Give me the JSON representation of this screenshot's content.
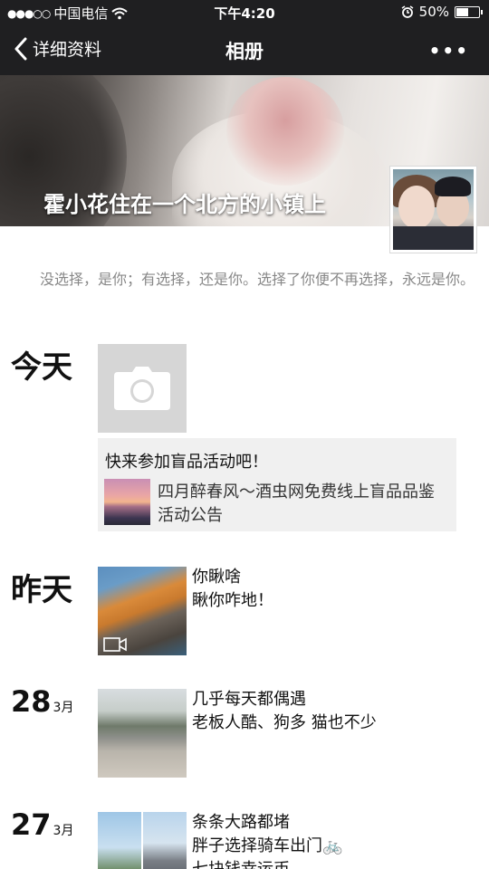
{
  "status_bar": {
    "carrier": "中国电信",
    "time": "下午4:20",
    "battery_percent": "50%",
    "battery_level": 0.5
  },
  "nav": {
    "back_label": "详细资料",
    "title": "相册",
    "more_label": "•••"
  },
  "cover": {
    "text": "霍小花住在一个北方的小镇上"
  },
  "signature": "没选择，是你；有选择，还是你。选择了你便不再选择，永远是你。",
  "timeline": {
    "today": {
      "label": "今天",
      "promo_title": "快来参加盲品活动吧！",
      "promo_text": "四月醉春风～酒虫网免费线上盲品品鉴活动公告"
    },
    "yesterday": {
      "label": "昨天",
      "line1": "你瞅啥",
      "line2": "瞅你咋地！"
    },
    "d28": {
      "day": "28",
      "month": "3月",
      "line1": "几乎每天都偶遇",
      "line2": "老板人酷、狗多  猫也不少"
    },
    "d27": {
      "day": "27",
      "month": "3月",
      "line1": "条条大路都堵",
      "line2": "胖子选择骑车出门🚲",
      "line3": "七块钱幸运币"
    }
  },
  "icons": {
    "back": "chevron-left-icon",
    "camera": "camera-icon",
    "video": "video-icon",
    "wifi": "wifi-icon",
    "alarm": "alarm-icon"
  }
}
